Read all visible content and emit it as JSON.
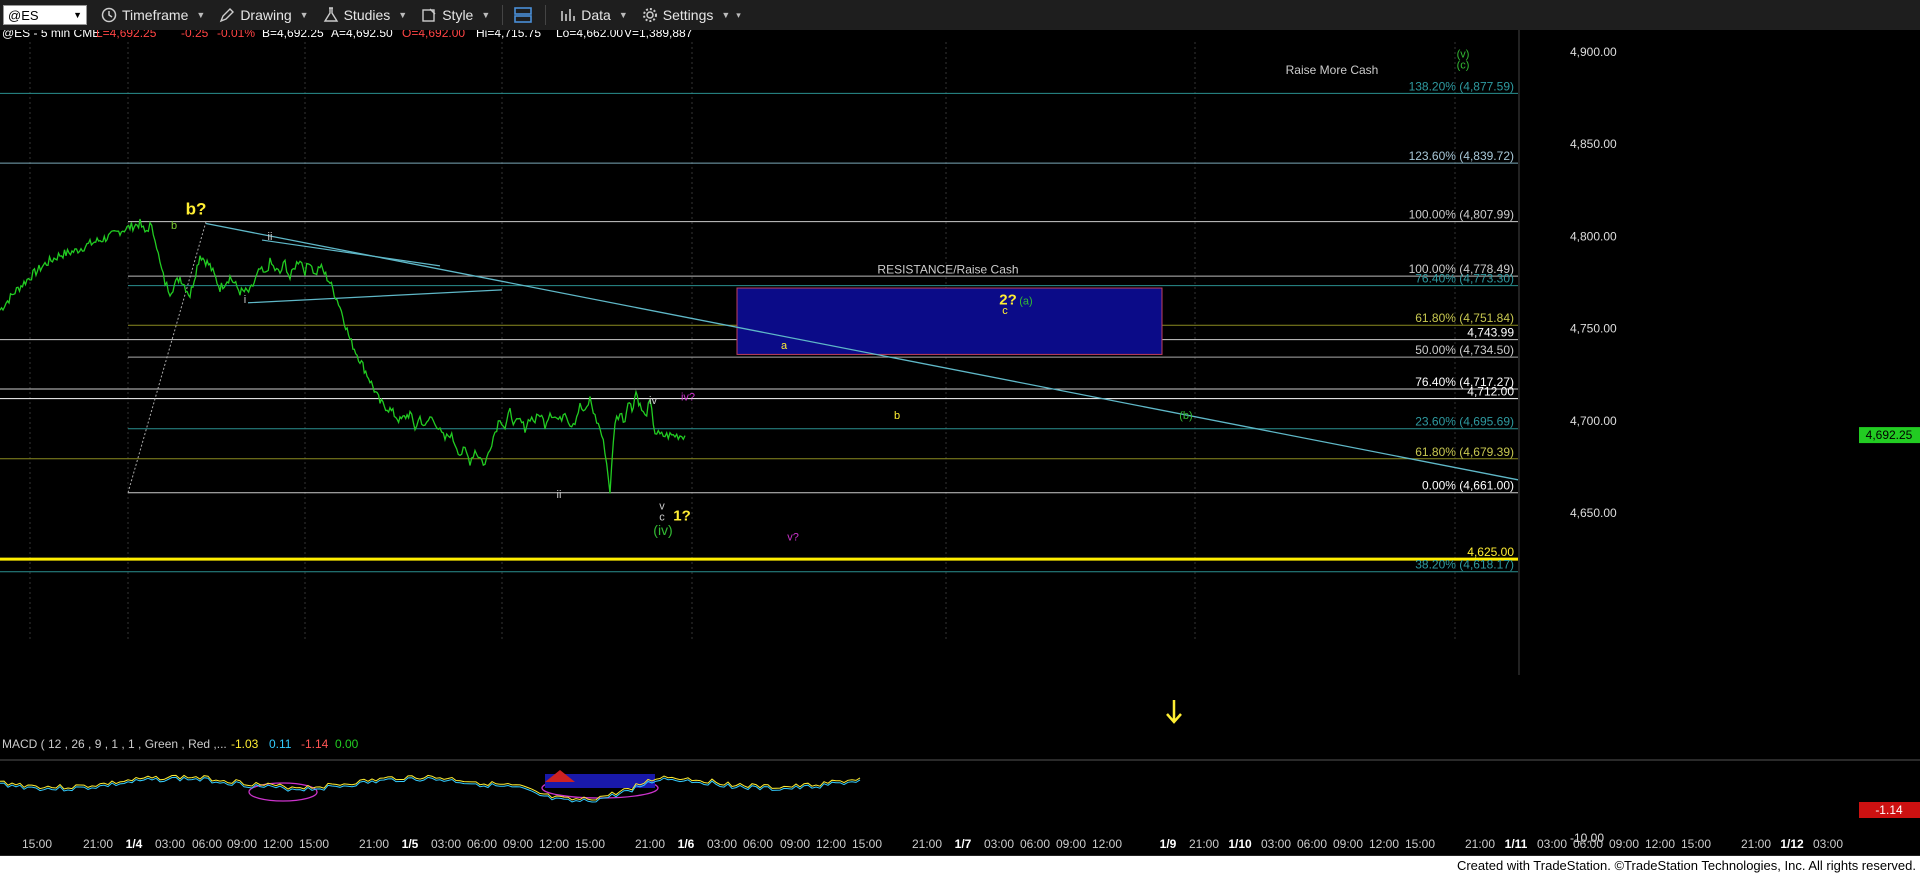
{
  "toolbar": {
    "symbol": "@ES",
    "items": [
      {
        "label": "Timeframe",
        "icon": "clock-icon"
      },
      {
        "label": "Drawing",
        "icon": "pencil-icon"
      },
      {
        "label": "Studies",
        "icon": "flask-icon"
      },
      {
        "label": "Style",
        "icon": "style-icon"
      },
      {
        "label": "Data",
        "icon": "bar-chart-icon"
      },
      {
        "label": "Settings",
        "icon": "gear-icon"
      }
    ]
  },
  "header": {
    "symbol": "@ES - 5 min CME",
    "last": "L=4,692.25",
    "change": "-0.25",
    "pct": "-0.01%",
    "bid": "B=4,692.25",
    "ask": "A=4,692.50",
    "open": "O=4,692.00",
    "high": "Hi=4,715.75",
    "low": "Lo=4,662.00",
    "volume": "V=1,389,887"
  },
  "colors": {
    "price": "#22cc22",
    "yellow": "#ffee33",
    "cyan_line": "#5fb8c8",
    "box_fill": "#0b0b88",
    "box_border": "#c04060",
    "magenta": "#cc33cc",
    "green_label": "#33bb33"
  },
  "chart_data": {
    "type": "line",
    "title": "@ES - 5 min CME",
    "ylim": [
      4600,
      4910
    ],
    "y_ticks": [
      "4,900.00",
      "4,850.00",
      "4,800.00",
      "4,750.00",
      "4,700.00",
      "4,650.00"
    ],
    "x_ticks": [
      "15:00",
      "21:00",
      "1/4",
      "03:00",
      "06:00",
      "09:00",
      "12:00",
      "15:00",
      "21:00",
      "1/5",
      "03:00",
      "06:00",
      "09:00",
      "12:00",
      "15:00",
      "21:00",
      "1/6",
      "03:00",
      "06:00",
      "09:00",
      "12:00",
      "15:00",
      "21:00",
      "1/7",
      "03:00",
      "06:00",
      "09:00",
      "12:00",
      "1/9",
      "21:00",
      "1/10",
      "03:00",
      "06:00",
      "09:00",
      "12:00",
      "15:00",
      "21:00",
      "1/11",
      "03:00",
      "06:00",
      "09:00",
      "12:00",
      "15:00",
      "21:00",
      "1/12",
      "03:00"
    ],
    "last_price": "4,692.25",
    "price_series": {
      "name": "@ES",
      "x": [
        0,
        15,
        30,
        45,
        60,
        75,
        90,
        100,
        110,
        120,
        130,
        140,
        145,
        150,
        155,
        160,
        165,
        170,
        180,
        190,
        200,
        210,
        220,
        230,
        240,
        250,
        260,
        265,
        270,
        275,
        280,
        285,
        290,
        295,
        300,
        305,
        310,
        315,
        320,
        330,
        340,
        350,
        360,
        370,
        380,
        390,
        400,
        410,
        415,
        420,
        425,
        430,
        435,
        440,
        445,
        450,
        455,
        460,
        465,
        470,
        475,
        480,
        485,
        490,
        495,
        500,
        505,
        510,
        515,
        520,
        525,
        530,
        535,
        540,
        545,
        550,
        555,
        560,
        565,
        570,
        575,
        580,
        585,
        590,
        595,
        600,
        605,
        610,
        615,
        620,
        625,
        628,
        632,
        636,
        640,
        645,
        650,
        655,
        660,
        665,
        670,
        675,
        680,
        685
      ],
      "y": [
        4760,
        4770,
        4778,
        4785,
        4790,
        4792,
        4796,
        4798,
        4800,
        4803,
        4805,
        4807,
        4802,
        4806,
        4800,
        4785,
        4775,
        4770,
        4778,
        4768,
        4790,
        4784,
        4772,
        4778,
        4770,
        4770,
        4782,
        4779,
        4786,
        4782,
        4780,
        4786,
        4777,
        4784,
        4788,
        4781,
        4787,
        4779,
        4784,
        4775,
        4762,
        4744,
        4733,
        4722,
        4710,
        4706,
        4700,
        4704,
        4696,
        4702,
        4696,
        4702,
        4700,
        4694,
        4690,
        4693,
        4688,
        4682,
        4684,
        4678,
        4684,
        4680,
        4676,
        4686,
        4694,
        4702,
        4696,
        4705,
        4698,
        4700,
        4696,
        4702,
        4700,
        4704,
        4698,
        4705,
        4702,
        4700,
        4706,
        4698,
        4700,
        4708,
        4704,
        4712,
        4702,
        4696,
        4684,
        4662,
        4700,
        4704,
        4700,
        4712,
        4706,
        4716,
        4708,
        4702,
        4710,
        4694,
        4692,
        4692,
        4692,
        4692,
        4692,
        4692
      ]
    },
    "fib_levels": [
      {
        "label": "138.20% (4,877.59)",
        "value": 4877.59
      },
      {
        "label": "123.60% (4,839.72)",
        "value": 4839.72
      },
      {
        "label": "100.00% (4,807.99)",
        "value": 4807.99
      },
      {
        "label": "100.00% (4,778.49)",
        "value": 4778.49
      },
      {
        "label": "76.40% (4,773.30)",
        "value": 4773.3
      },
      {
        "label": "61.80% (4,751.84)",
        "value": 4751.84
      },
      {
        "label": "4,743.99",
        "value": 4743.99
      },
      {
        "label": "50.00% (4,734.50)",
        "value": 4734.5
      },
      {
        "label": "76.40% (4,717.27)",
        "value": 4717.27
      },
      {
        "label": "4,712.00",
        "value": 4712.0
      },
      {
        "label": "23.60% (4,695.69)",
        "value": 4695.69
      },
      {
        "label": "61.80% (4,679.39)",
        "value": 4679.39
      },
      {
        "label": "0.00% (4,661.00)",
        "value": 4661.0
      },
      {
        "label": "4,625.00",
        "value": 4625.0
      },
      {
        "label": "38.20% (4,618.17)",
        "value": 4618.17
      }
    ],
    "annotations": [
      {
        "text": "b?",
        "x": 196,
        "y": 4812
      },
      {
        "text": "b",
        "x": 174,
        "y": 4804
      },
      {
        "text": "ii",
        "x": 270,
        "y": 4798
      },
      {
        "text": "i",
        "x": 245,
        "y": 4764
      },
      {
        "text": "iv",
        "x": 653,
        "y": 4709
      },
      {
        "text": "iv?",
        "x": 688,
        "y": 4711
      },
      {
        "text": "ii",
        "x": 559,
        "y": 4658
      },
      {
        "text": "v",
        "x": 662,
        "y": 4652
      },
      {
        "text": "c",
        "x": 662,
        "y": 4646
      },
      {
        "text": "1?",
        "x": 682,
        "y": 4646
      },
      {
        "text": "(iv)",
        "x": 663,
        "y": 4638
      },
      {
        "text": "v?",
        "x": 793,
        "y": 4635
      },
      {
        "text": "a",
        "x": 784,
        "y": 4739
      },
      {
        "text": "b",
        "x": 897,
        "y": 4701
      },
      {
        "text": "2?",
        "x": 1008,
        "y": 4763
      },
      {
        "text": "(a)",
        "x": 1026,
        "y": 4763
      },
      {
        "text": "c",
        "x": 1005,
        "y": 4758
      },
      {
        "text": "(b)",
        "x": 1186,
        "y": 4701
      },
      {
        "text": "(v)",
        "x": 1463,
        "y": 4897
      },
      {
        "text": "(c)",
        "x": 1463,
        "y": 4891
      },
      {
        "text": "RESISTANCE/Raise Cash",
        "x": 948,
        "y": 4780
      },
      {
        "text": "Raise More Cash",
        "x": 1332,
        "y": 4888
      }
    ],
    "resistance_box": {
      "x_start": 737,
      "x_end": 1162,
      "y_top": 4772,
      "y_bottom": 4736
    },
    "macd": {
      "label": "MACD ( 12 , 26 , 9 , 1 , 1 , Green , Red ,...",
      "v1": "-1.03",
      "v2": "0.11",
      "v3": "-1.14",
      "v4": "0.00",
      "tick": "-10.00",
      "last": "-1.14"
    }
  },
  "footer": "Created with TradeStation. ©TradeStation Technologies, Inc. All rights reserved."
}
